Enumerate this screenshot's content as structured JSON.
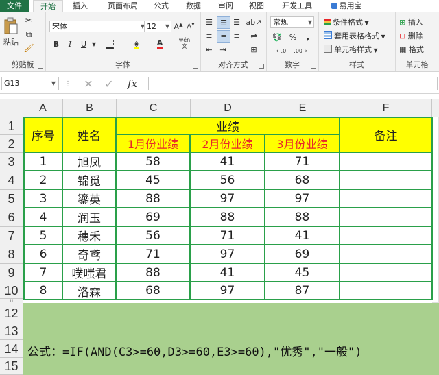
{
  "ribbon_tabs": [
    "文件",
    "开始",
    "插入",
    "页面布局",
    "公式",
    "数据",
    "审阅",
    "视图",
    "开发工具",
    "易用宝"
  ],
  "clipboard": {
    "paste_label": "粘贴",
    "group_label": "剪贴板"
  },
  "font": {
    "name": "宋体",
    "size": "12",
    "bold": "B",
    "italic": "I",
    "underline": "U",
    "phonetic": "wén",
    "group_label": "字体"
  },
  "alignment": {
    "group_label": "对齐方式"
  },
  "number": {
    "format": "常规",
    "percent": "%",
    "comma": ",",
    "group_label": "数字"
  },
  "styles": {
    "conditional": "条件格式",
    "table": "套用表格格式",
    "cell": "单元格样式",
    "group_label": "样式"
  },
  "cells": {
    "insert": "插入",
    "delete": "删除",
    "format": "格式",
    "group_label": "单元格"
  },
  "formula_bar": {
    "name_box": "G13",
    "fx": "fx",
    "value": ""
  },
  "columns": [
    "A",
    "B",
    "C",
    "D",
    "E",
    "F"
  ],
  "rows": [
    "1",
    "2",
    "3",
    "4",
    "5",
    "6",
    "7",
    "8",
    "9",
    "10",
    "11",
    "12",
    "13",
    "14",
    "15"
  ],
  "table": {
    "hdr_seq": "序号",
    "hdr_name": "姓名",
    "hdr_perf": "业绩",
    "hdr_note": "备注",
    "months": [
      "1月份业绩",
      "2月份业绩",
      "3月份业绩"
    ],
    "data": [
      [
        "1",
        "旭凤",
        "58",
        "41",
        "71"
      ],
      [
        "2",
        "锦觅",
        "45",
        "56",
        "68"
      ],
      [
        "3",
        "鎏英",
        "88",
        "97",
        "97"
      ],
      [
        "4",
        "润玉",
        "69",
        "88",
        "88"
      ],
      [
        "5",
        "穗禾",
        "56",
        "71",
        "41"
      ],
      [
        "6",
        "奇鸢",
        "71",
        "97",
        "69"
      ],
      [
        "7",
        "噗嗤君",
        "88",
        "41",
        "45"
      ],
      [
        "8",
        "洛霖",
        "68",
        "97",
        "87"
      ]
    ]
  },
  "note": "公式：=IF(AND(C3>=60,D3>=60,E3>=60),\"优秀\",\"一般\")",
  "colors": {
    "accent": "#217346",
    "yellow": "#ffff00",
    "red_text": "#e8262a",
    "green_border": "#2aa04a",
    "note_bg": "#a9d08e"
  }
}
